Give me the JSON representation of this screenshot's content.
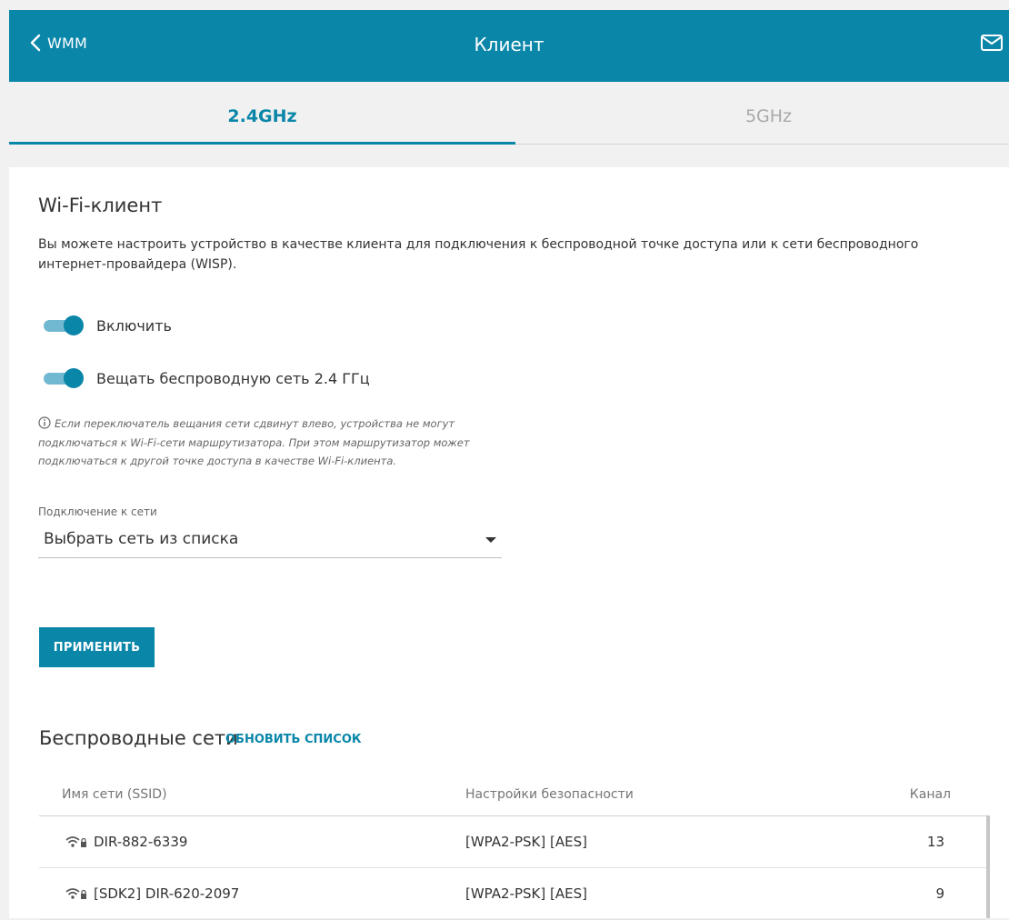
{
  "header": {
    "back_label": "WMM",
    "title": "Клиент",
    "icons": {
      "back": "chevron-left-icon",
      "mail": "mail-icon"
    }
  },
  "tabs": [
    {
      "label": "2.4GHz",
      "active": true
    },
    {
      "label": "5GHz",
      "active": false
    }
  ],
  "section": {
    "title": "Wi-Fi-клиент",
    "description": "Вы можете настроить устройство в качестве клиента для подключения к беспроводной точке доступа или к сети беспроводного интернет-провайдера (WISP).",
    "toggles": [
      {
        "label": "Включить",
        "on": true
      },
      {
        "label": "Вещать беспроводную сеть 2.4 ГГц",
        "on": true
      }
    ],
    "note": "Если переключатель вещания сети сдвинут влево, устройства не могут подключаться к Wi-Fi-сети маршрутизатора. При этом маршрутизатор может подключаться к другой точке доступа в качестве Wi-Fi-клиента.",
    "connection": {
      "label": "Подключение к сети",
      "value": "Выбрать сеть из списка"
    },
    "apply_label": "ПРИМЕНИТЬ"
  },
  "networks": {
    "title": "Беспроводные сети",
    "refresh_label": "ОБНОВИТЬ СПИСОК",
    "columns": {
      "ssid": "Имя сети (SSID)",
      "security": "Настройки безопасности",
      "channel": "Канал"
    },
    "rows": [
      {
        "ssid": "DIR-882-6339",
        "security": "[WPA2-PSK] [AES]",
        "channel": "13"
      },
      {
        "ssid": "[SDK2] DIR-620-2097",
        "security": "[WPA2-PSK] [AES]",
        "channel": "9"
      }
    ]
  },
  "colors": {
    "accent": "#0a86a9",
    "accent_light": "#70b9d0",
    "background": "#f1f1f1"
  }
}
